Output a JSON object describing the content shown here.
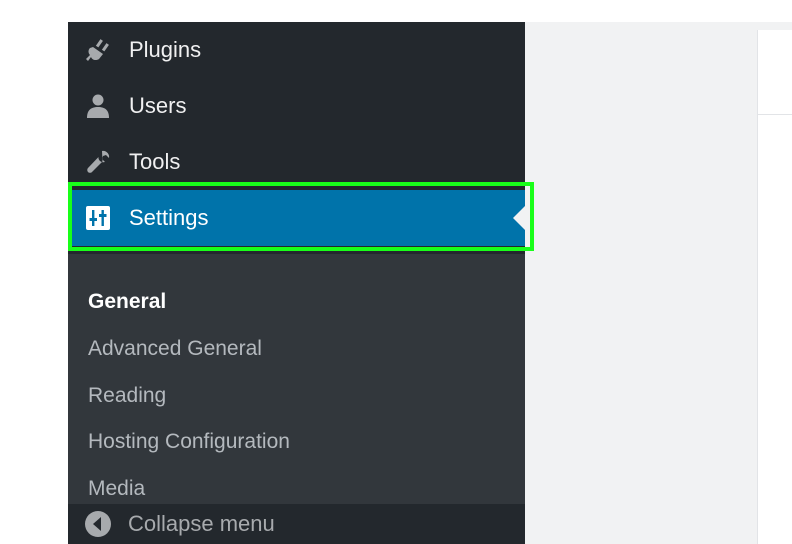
{
  "sidebar": {
    "items": [
      {
        "label": "Plugins",
        "icon": "plugin-icon"
      },
      {
        "label": "Users",
        "icon": "user-icon"
      },
      {
        "label": "Tools",
        "icon": "wrench-icon"
      },
      {
        "label": "Settings",
        "icon": "settings-sliders-icon",
        "active": true
      }
    ],
    "submenu": [
      {
        "label": "General",
        "current": true
      },
      {
        "label": "Advanced General"
      },
      {
        "label": "Reading"
      },
      {
        "label": "Hosting Configuration"
      },
      {
        "label": "Media"
      }
    ],
    "collapse_label": "Collapse menu"
  },
  "colors": {
    "sidebar_bg": "#23282d",
    "submenu_bg": "#32373c",
    "active_bg": "#0073aa",
    "highlight": "#19ff19"
  }
}
